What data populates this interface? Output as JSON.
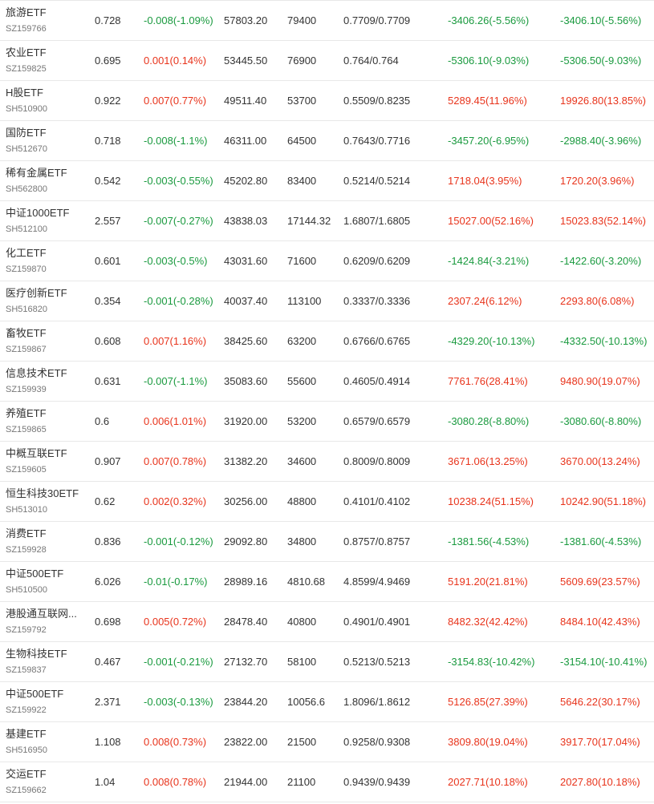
{
  "colors": {
    "up": "#e8341c",
    "down": "#1a9a3f"
  },
  "rows": [
    {
      "name": "旅游ETF",
      "code": "SZ159766",
      "price": "0.728",
      "change": "-0.008(-1.09%)",
      "change_dir": "down",
      "amount": "57803.20",
      "volume": "79400",
      "range": "0.7709/0.7709",
      "p1": "-3406.26(-5.56%)",
      "p1_dir": "down",
      "p2": "-3406.10(-5.56%)",
      "p2_dir": "down"
    },
    {
      "name": "农业ETF",
      "code": "SZ159825",
      "price": "0.695",
      "change": "0.001(0.14%)",
      "change_dir": "up",
      "amount": "53445.50",
      "volume": "76900",
      "range": "0.764/0.764",
      "p1": "-5306.10(-9.03%)",
      "p1_dir": "down",
      "p2": "-5306.50(-9.03%)",
      "p2_dir": "down"
    },
    {
      "name": "H股ETF",
      "code": "SH510900",
      "price": "0.922",
      "change": "0.007(0.77%)",
      "change_dir": "up",
      "amount": "49511.40",
      "volume": "53700",
      "range": "0.5509/0.8235",
      "p1": "5289.45(11.96%)",
      "p1_dir": "up",
      "p2": "19926.80(13.85%)",
      "p2_dir": "up"
    },
    {
      "name": "国防ETF",
      "code": "SH512670",
      "price": "0.718",
      "change": "-0.008(-1.1%)",
      "change_dir": "down",
      "amount": "46311.00",
      "volume": "64500",
      "range": "0.7643/0.7716",
      "p1": "-3457.20(-6.95%)",
      "p1_dir": "down",
      "p2": "-2988.40(-3.96%)",
      "p2_dir": "down"
    },
    {
      "name": "稀有金属ETF",
      "code": "SH562800",
      "price": "0.542",
      "change": "-0.003(-0.55%)",
      "change_dir": "down",
      "amount": "45202.80",
      "volume": "83400",
      "range": "0.5214/0.5214",
      "p1": "1718.04(3.95%)",
      "p1_dir": "up",
      "p2": "1720.20(3.96%)",
      "p2_dir": "up"
    },
    {
      "name": "中证1000ETF",
      "code": "SH512100",
      "price": "2.557",
      "change": "-0.007(-0.27%)",
      "change_dir": "down",
      "amount": "43838.03",
      "volume": "17144.32",
      "range": "1.6807/1.6805",
      "p1": "15027.00(52.16%)",
      "p1_dir": "up",
      "p2": "15023.83(52.14%)",
      "p2_dir": "up"
    },
    {
      "name": "化工ETF",
      "code": "SZ159870",
      "price": "0.601",
      "change": "-0.003(-0.5%)",
      "change_dir": "down",
      "amount": "43031.60",
      "volume": "71600",
      "range": "0.6209/0.6209",
      "p1": "-1424.84(-3.21%)",
      "p1_dir": "down",
      "p2": "-1422.60(-3.20%)",
      "p2_dir": "down"
    },
    {
      "name": "医疗创新ETF",
      "code": "SH516820",
      "price": "0.354",
      "change": "-0.001(-0.28%)",
      "change_dir": "down",
      "amount": "40037.40",
      "volume": "113100",
      "range": "0.3337/0.3336",
      "p1": "2307.24(6.12%)",
      "p1_dir": "up",
      "p2": "2293.80(6.08%)",
      "p2_dir": "up"
    },
    {
      "name": "畜牧ETF",
      "code": "SZ159867",
      "price": "0.608",
      "change": "0.007(1.16%)",
      "change_dir": "up",
      "amount": "38425.60",
      "volume": "63200",
      "range": "0.6766/0.6765",
      "p1": "-4329.20(-10.13%)",
      "p1_dir": "down",
      "p2": "-4332.50(-10.13%)",
      "p2_dir": "down"
    },
    {
      "name": "信息技术ETF",
      "code": "SZ159939",
      "price": "0.631",
      "change": "-0.007(-1.1%)",
      "change_dir": "down",
      "amount": "35083.60",
      "volume": "55600",
      "range": "0.4605/0.4914",
      "p1": "7761.76(28.41%)",
      "p1_dir": "up",
      "p2": "9480.90(19.07%)",
      "p2_dir": "up"
    },
    {
      "name": "养殖ETF",
      "code": "SZ159865",
      "price": "0.6",
      "change": "0.006(1.01%)",
      "change_dir": "up",
      "amount": "31920.00",
      "volume": "53200",
      "range": "0.6579/0.6579",
      "p1": "-3080.28(-8.80%)",
      "p1_dir": "down",
      "p2": "-3080.60(-8.80%)",
      "p2_dir": "down"
    },
    {
      "name": "中概互联ETF",
      "code": "SZ159605",
      "price": "0.907",
      "change": "0.007(0.78%)",
      "change_dir": "up",
      "amount": "31382.20",
      "volume": "34600",
      "range": "0.8009/0.8009",
      "p1": "3671.06(13.25%)",
      "p1_dir": "up",
      "p2": "3670.00(13.24%)",
      "p2_dir": "up"
    },
    {
      "name": "恒生科技30ETF",
      "code": "SH513010",
      "price": "0.62",
      "change": "0.002(0.32%)",
      "change_dir": "up",
      "amount": "30256.00",
      "volume": "48800",
      "range": "0.4101/0.4102",
      "p1": "10238.24(51.15%)",
      "p1_dir": "up",
      "p2": "10242.90(51.18%)",
      "p2_dir": "up"
    },
    {
      "name": "消费ETF",
      "code": "SZ159928",
      "price": "0.836",
      "change": "-0.001(-0.12%)",
      "change_dir": "down",
      "amount": "29092.80",
      "volume": "34800",
      "range": "0.8757/0.8757",
      "p1": "-1381.56(-4.53%)",
      "p1_dir": "down",
      "p2": "-1381.60(-4.53%)",
      "p2_dir": "down"
    },
    {
      "name": "中证500ETF",
      "code": "SH510500",
      "price": "6.026",
      "change": "-0.01(-0.17%)",
      "change_dir": "down",
      "amount": "28989.16",
      "volume": "4810.68",
      "range": "4.8599/4.9469",
      "p1": "5191.20(21.81%)",
      "p1_dir": "up",
      "p2": "5609.69(23.57%)",
      "p2_dir": "up"
    },
    {
      "name": "港股通互联网...",
      "code": "SZ159792",
      "price": "0.698",
      "change": "0.005(0.72%)",
      "change_dir": "up",
      "amount": "28478.40",
      "volume": "40800",
      "range": "0.4901/0.4901",
      "p1": "8482.32(42.42%)",
      "p1_dir": "up",
      "p2": "8484.10(42.43%)",
      "p2_dir": "up"
    },
    {
      "name": "生物科技ETF",
      "code": "SZ159837",
      "price": "0.467",
      "change": "-0.001(-0.21%)",
      "change_dir": "down",
      "amount": "27132.70",
      "volume": "58100",
      "range": "0.5213/0.5213",
      "p1": "-3154.83(-10.42%)",
      "p1_dir": "down",
      "p2": "-3154.10(-10.41%)",
      "p2_dir": "down"
    },
    {
      "name": "中证500ETF",
      "code": "SZ159922",
      "price": "2.371",
      "change": "-0.003(-0.13%)",
      "change_dir": "down",
      "amount": "23844.20",
      "volume": "10056.6",
      "range": "1.8096/1.8612",
      "p1": "5126.85(27.39%)",
      "p1_dir": "up",
      "p2": "5646.22(30.17%)",
      "p2_dir": "up"
    },
    {
      "name": "基建ETF",
      "code": "SH516950",
      "price": "1.108",
      "change": "0.008(0.73%)",
      "change_dir": "up",
      "amount": "23822.00",
      "volume": "21500",
      "range": "0.9258/0.9308",
      "p1": "3809.80(19.04%)",
      "p1_dir": "up",
      "p2": "3917.70(17.04%)",
      "p2_dir": "up"
    },
    {
      "name": "交运ETF",
      "code": "SZ159662",
      "price": "1.04",
      "change": "0.008(0.78%)",
      "change_dir": "up",
      "amount": "21944.00",
      "volume": "21100",
      "range": "0.9439/0.9439",
      "p1": "2027.71(10.18%)",
      "p1_dir": "up",
      "p2": "2027.80(10.18%)",
      "p2_dir": "up"
    }
  ]
}
